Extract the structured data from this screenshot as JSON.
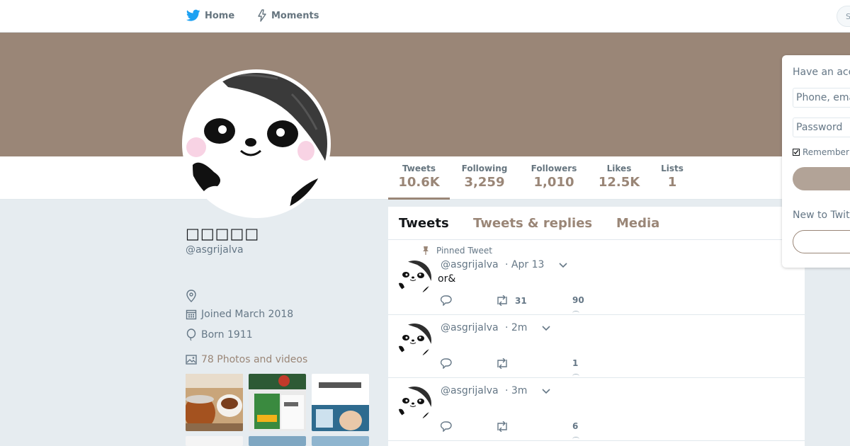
{
  "nav": {
    "home_label": "Home",
    "moments_label": "Moments",
    "search_placeholder": "S"
  },
  "profile": {
    "name": "□□□□□",
    "handle": "@asgrijalva",
    "location": "",
    "joined": "Joined March 2018",
    "born": "Born 1911",
    "photos_label": "78 Photos and videos"
  },
  "stats": [
    {
      "label": "Tweets",
      "value": "10.6K"
    },
    {
      "label": "Following",
      "value": "3,259"
    },
    {
      "label": "Followers",
      "value": "1,010"
    },
    {
      "label": "Likes",
      "value": "12.5K"
    },
    {
      "label": "Lists",
      "value": "1"
    }
  ],
  "tabs": [
    "Tweets",
    "Tweets & replies",
    "Media"
  ],
  "pinned_label": "Pinned Tweet",
  "tweets": [
    {
      "handle": "@asgrijalva",
      "time": "· Apr 13",
      "text": "or&",
      "retweets": "31",
      "likes": "90"
    },
    {
      "handle": "@asgrijalva",
      "time": "· 2m",
      "text": "",
      "retweets": "",
      "likes": "1"
    },
    {
      "handle": "@asgrijalva",
      "time": "· 3m",
      "text": "",
      "retweets": "",
      "likes": "6"
    }
  ],
  "login": {
    "title": "Have an acc",
    "username_placeholder": "Phone, ema",
    "password_placeholder": "Password",
    "remember_label": "Remember",
    "signup_title": "New to Twit"
  },
  "colors": {
    "accent": "#9a8677",
    "background": "#e6ecf0",
    "banner": "#9a8677"
  }
}
